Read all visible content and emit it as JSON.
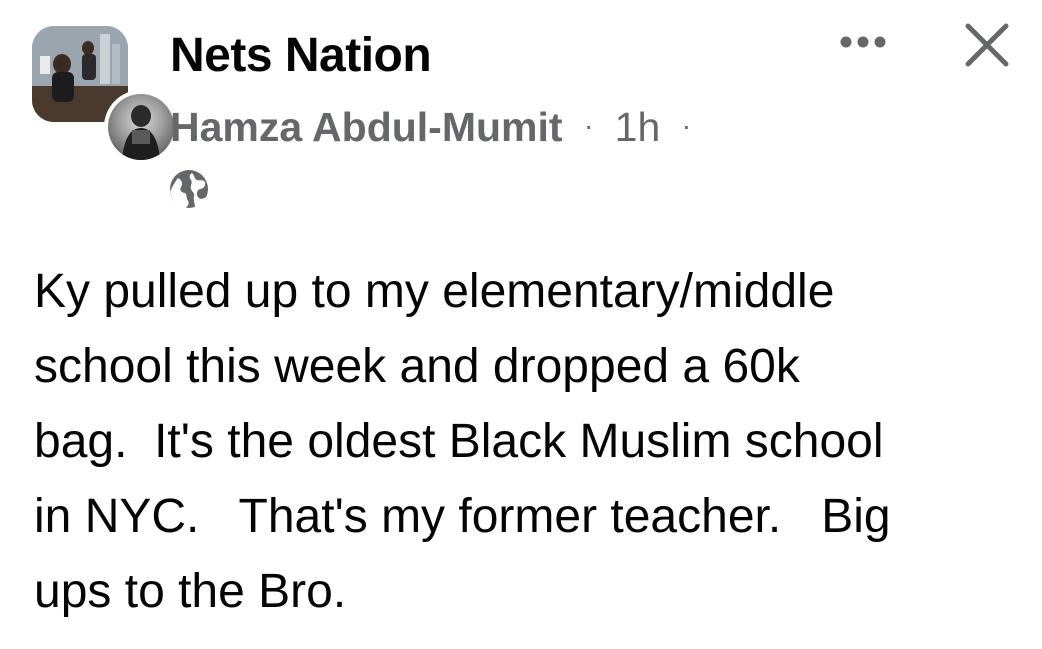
{
  "post": {
    "group_name": "Nets Nation",
    "author": "Hamza Abdul-Mumit",
    "separator": "·",
    "timestamp": "1h",
    "visibility_icon": "globe-icon",
    "more_icon": "more-options-icon",
    "close_icon": "close-icon",
    "text_lines": [
      "Ky pulled up to my elementary/middle",
      "school this week and dropped a 60k",
      "bag.  It's the oldest Black Muslim school",
      "in NYC.   That's my former teacher.   Big",
      "ups to the Bro."
    ]
  },
  "colors": {
    "primary_text": "#050505",
    "secondary_text": "#65676b",
    "icon": "#65676b",
    "background": "#ffffff"
  }
}
